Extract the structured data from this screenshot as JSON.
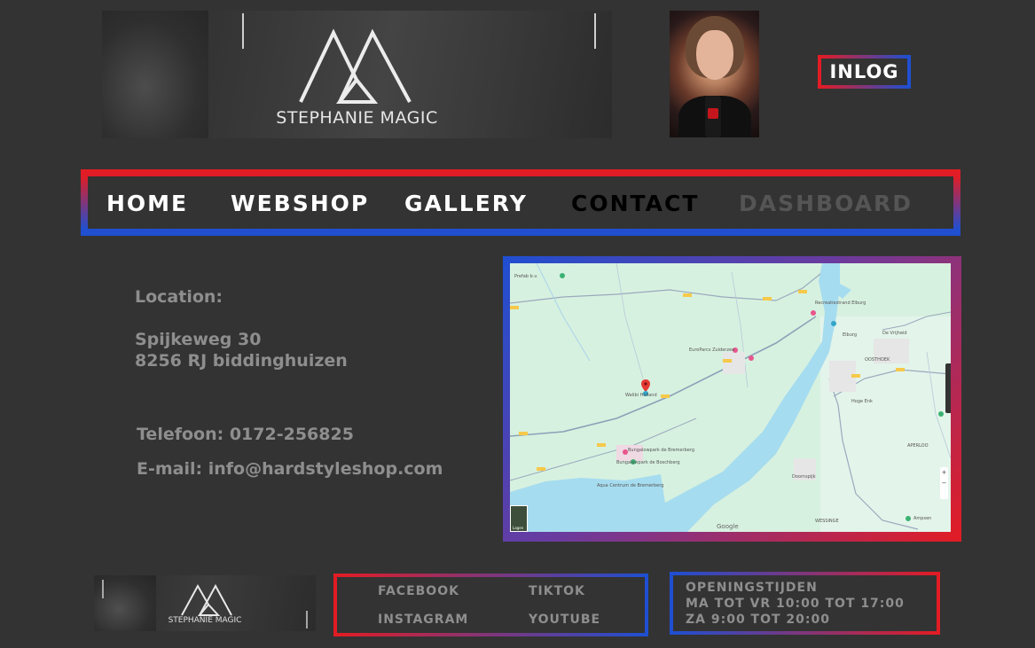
{
  "header": {
    "brand_name": "STEPHANIE MAGIC",
    "login_label": "INLOG"
  },
  "nav": {
    "items": [
      {
        "label": "HOME",
        "color": "#ffffff"
      },
      {
        "label": "WEBSHOP",
        "color": "#ffffff"
      },
      {
        "label": "GALLERY",
        "color": "#ffffff"
      },
      {
        "label": "CONTACT",
        "color": "#000000"
      },
      {
        "label": "DASHBOARD",
        "color": "#555555"
      }
    ]
  },
  "contact": {
    "location_heading": "Location:",
    "street": "Spijkeweg 30",
    "city": "8256 RJ biddinghuizen",
    "phone": "Telefoon: 0172-256825",
    "email": "E-mail: info@hardstyleshop.com"
  },
  "map": {
    "labels": {
      "walibi": "Walibi Holland",
      "europarcs": "EuroParcs Zuiderzee",
      "bremerberg": "Bungalowpark de Bremerberg",
      "boschberg": "Bungalowpark de Boschberg",
      "aqua": "Aqua Centrum de Bremerberg",
      "elburg": "Elburg",
      "vrijheid": "De Vrijheid",
      "hoge_enk": "Hoge Enk",
      "doornspijk": "Doornspijk",
      "oosthoek": "OOSTHOEK",
      "wessinge": "WESSINGE",
      "aperloo": "APERLOO",
      "ampsen": "Ampsen",
      "recreatie": "Recreatiestrand Elburg",
      "prefab": "Prefab b.v."
    },
    "google_label": "Google",
    "layers_label": "Lagen"
  },
  "footer": {
    "brand_name": "STEPHANIE MAGIC",
    "social": {
      "facebook": "FACEBOOK",
      "tiktok": "TIKTOK",
      "instagram": "INSTAGRAM",
      "youtube": "YOUTUBE"
    },
    "hours": {
      "title": "OPENINGSTIJDEN",
      "weekdays": "MA TOT VR 10:00 TOT 17:00",
      "weekend": "ZA 9:00 TOT 20:00"
    }
  },
  "colors": {
    "accent_red": "#e21c24",
    "accent_blue": "#1f4fd1",
    "background": "#333333",
    "text_grey": "#8e8e8e"
  }
}
